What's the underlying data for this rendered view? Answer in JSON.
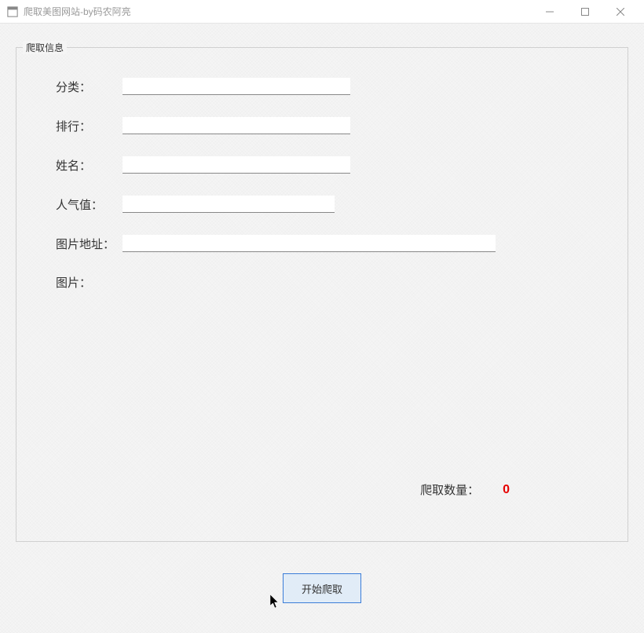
{
  "window": {
    "title": "爬取美图网站-by码农阿亮"
  },
  "groupbox": {
    "title": "爬取信息"
  },
  "form": {
    "category": {
      "label": "分类：",
      "value": ""
    },
    "ranking": {
      "label": "排行：",
      "value": ""
    },
    "name": {
      "label": "姓名：",
      "value": ""
    },
    "popularity": {
      "label": "人气值：",
      "value": ""
    },
    "image_url": {
      "label": "图片地址：",
      "value": ""
    },
    "image": {
      "label": "图片："
    }
  },
  "count": {
    "label": "爬取数量：",
    "value": "0"
  },
  "button": {
    "start": "开始爬取"
  }
}
